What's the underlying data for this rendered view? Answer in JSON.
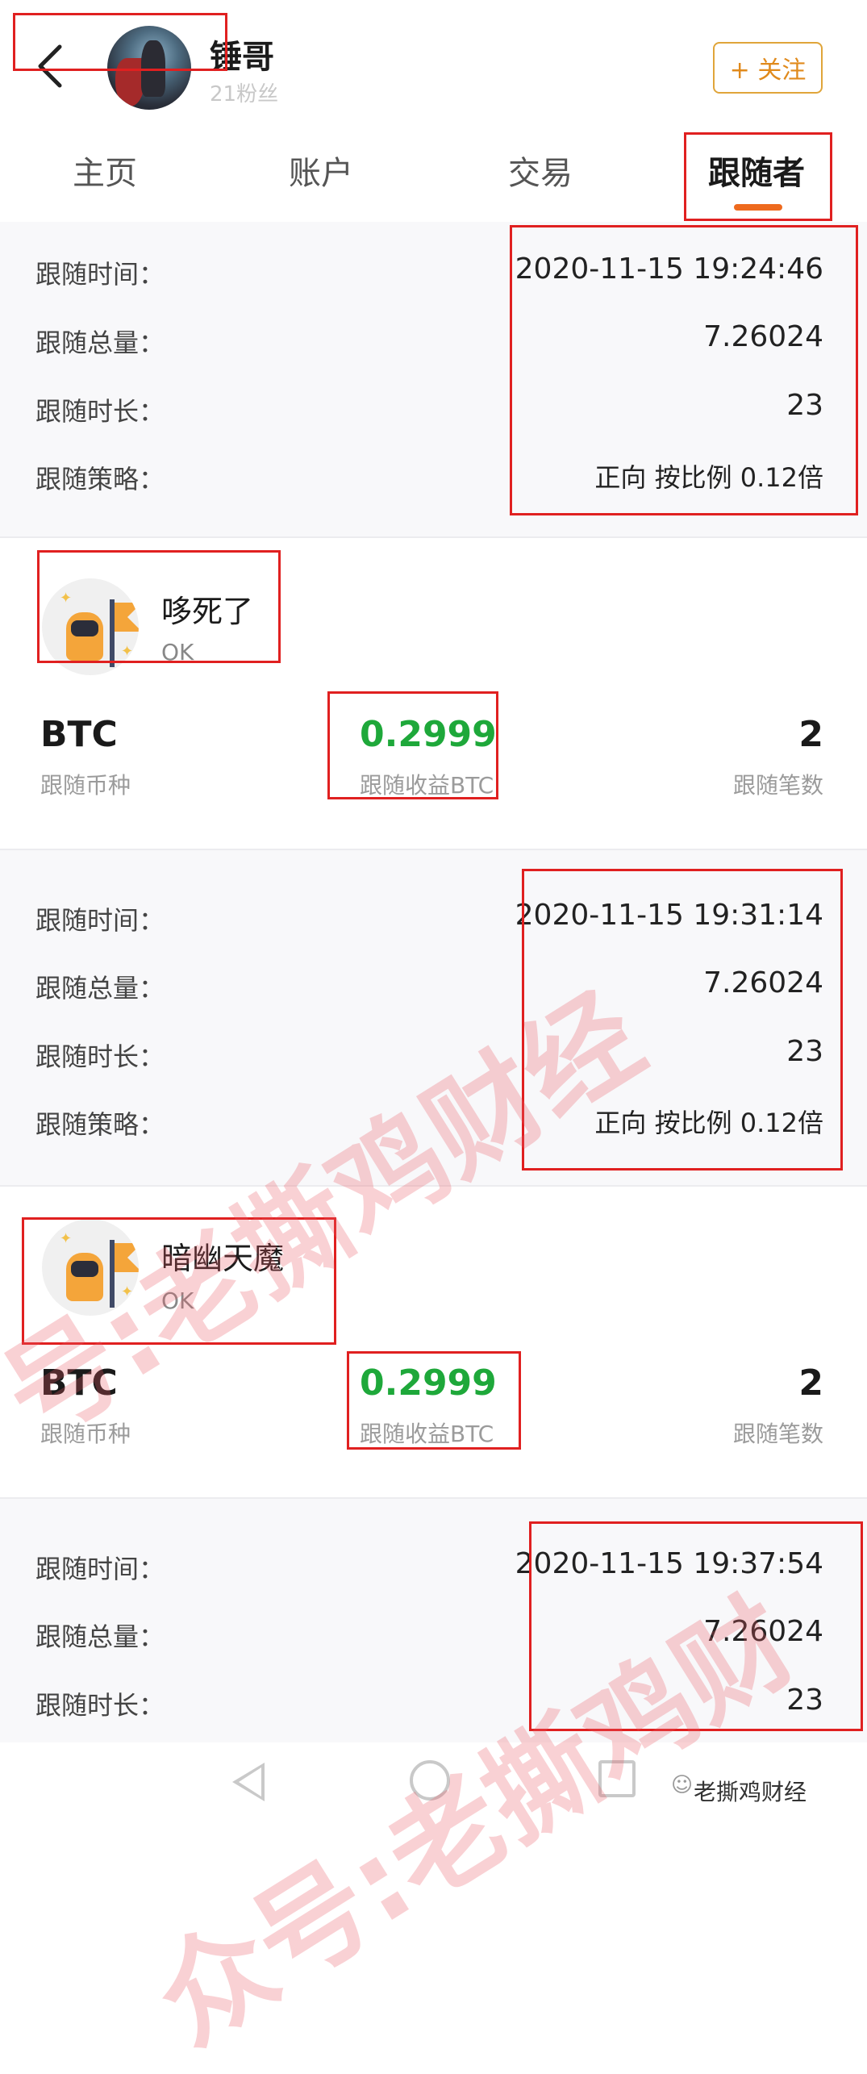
{
  "header": {
    "user_name": "锤哥",
    "fans": "21粉丝",
    "follow_label": "+ 关注"
  },
  "tabs": [
    "主页",
    "账户",
    "交易",
    "跟随者"
  ],
  "labels": {
    "follow_time": "跟随时间：",
    "follow_total": "跟随总量：",
    "follow_duration": "跟随时长：",
    "follow_strategy": "跟随策略：",
    "follow_coin": "跟随币种",
    "follow_profit": "跟随收益BTC",
    "follow_trades": "跟随笔数"
  },
  "records": [
    {
      "time": "2020-11-15 19:24:46",
      "total": "7.26024",
      "duration": "23",
      "strategy": "正向 按比例 0.12倍",
      "user": "哆死了",
      "status": "OK",
      "coin": "BTC",
      "profit": "0.2999",
      "trades": "2"
    },
    {
      "time": "2020-11-15 19:31:14",
      "total": "7.26024",
      "duration": "23",
      "strategy": "正向 按比例 0.12倍",
      "user": "暗幽天魔",
      "status": "OK",
      "coin": "BTC",
      "profit": "0.2999",
      "trades": "2"
    },
    {
      "time": "2020-11-15 19:37:54",
      "total": "7.26024",
      "duration": "23"
    }
  ],
  "watermark": {
    "text_a": "号:老撕鸡财经",
    "text_b": "众号:老撕鸡财"
  },
  "branding": "老撕鸡财经"
}
